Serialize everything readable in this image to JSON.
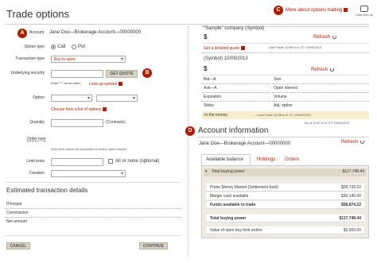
{
  "page": {
    "title": "Trade options"
  },
  "top_link": {
    "label": "More about options trading",
    "chat": "Chat with us"
  },
  "badges": {
    "a": "A",
    "b": "B",
    "c": "C",
    "d": "D"
  },
  "form": {
    "account_label": "Account",
    "account_value": "Jane Doe—Brokerage Account—00000000",
    "option_type_label": "Option type",
    "call": "Call",
    "put": "Put",
    "transaction_type_label": "Transaction type",
    "transaction_type_value": "Buy to open",
    "underlying_label": "Underlying security",
    "get_quote": "GET QUOTE",
    "index_hint": "Enter \"^\" for an index.",
    "lookup_symbol": "Look up symbol",
    "option_label": "Option",
    "choose_options": "Choose from a list of options",
    "quantity_label": "Quantity",
    "contracts": "(Contracts)",
    "order_type_label": "Order type",
    "order_type_note": "Only limit orders are accepted for online option trades.",
    "limit_price_label": "Limit price",
    "all_or_none": "All or none (optional)",
    "duration_label": "Duration"
  },
  "estimated": {
    "title": "Estimated transaction details",
    "principal": "Principal",
    "commission": "Commission",
    "net_amount": "Net amount"
  },
  "buttons": {
    "cancel": "CANCEL",
    "continue": "CONTINUE"
  },
  "quote1": {
    "title": "\"Sample\" company (Symbol)",
    "dollar": "$",
    "refresh": "Refresh",
    "detailed": "Get a detailed quote",
    "last_trade": "Last Trade 10:58 a.m. ET 10/09/2013"
  },
  "quote2": {
    "title": "(Symbol) 10/09/2013",
    "dollar": "$",
    "refresh": "Refresh",
    "left_fields": [
      "Bid—A",
      "Ask—A",
      "Expiration",
      "Strike"
    ],
    "right_fields": [
      "Size",
      "Open interest",
      "Volume",
      "Adj. option"
    ],
    "in_money": "In the money",
    "last_trade": "—Last Trade 10:58 a.m. ET 10/09/2013"
  },
  "account_info": {
    "timestamp": "As of 10:57 a.m. ET 10/09/2013",
    "title": "Account information",
    "account": "Jane Doe—Brokerage Account—00000000",
    "refresh": "Refresh",
    "tabs": [
      "Available balance",
      "Holdings",
      "Orders"
    ],
    "total_buying_power_label": "Total buying power",
    "total_buying_power_value": "$117,748.44",
    "rows": [
      {
        "k": "Prime Money Market (Settlement fund)",
        "v": "$28,729.22",
        "bold": false
      },
      {
        "k": "Margin cash available",
        "v": "$30,145.00",
        "bold": false
      },
      {
        "k": "Funds available to trade",
        "v": "$58,874.22",
        "bold": true
      },
      {
        "k": "Total buying power",
        "v": "$117,748.44",
        "bold": true
      },
      {
        "k": "Value of open buy limit orders",
        "v": "$3,500.00",
        "bold": false
      }
    ]
  },
  "colors": {
    "accent": "#b41c00",
    "badge": "#b01c00",
    "highlight": "#f6edce",
    "panel": "#efebe3"
  }
}
